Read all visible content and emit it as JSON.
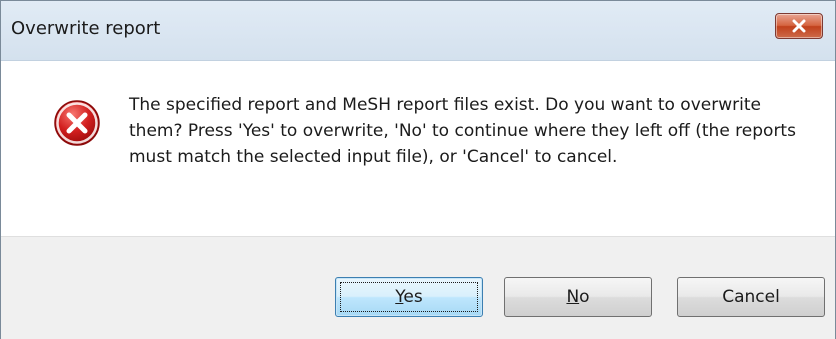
{
  "window": {
    "title": "Overwrite report"
  },
  "message": {
    "text": "The specified report and MeSH report files exist. Do you want to overwrite them? Press 'Yes' to overwrite, 'No' to continue where they left off (the reports must match the selected input file), or 'Cancel' to cancel."
  },
  "icons": {
    "close": "close-icon",
    "error": "error-icon"
  },
  "buttons": {
    "yes": {
      "mnemonic": "Y",
      "rest": "es"
    },
    "no": {
      "mnemonic": "N",
      "rest": "o"
    },
    "cancel": {
      "label": "Cancel"
    }
  },
  "colors": {
    "close_button": "#c7462a",
    "error_red": "#d21f1f",
    "default_button_border": "#3c7fb1",
    "button_area": "#f0f0f0"
  }
}
